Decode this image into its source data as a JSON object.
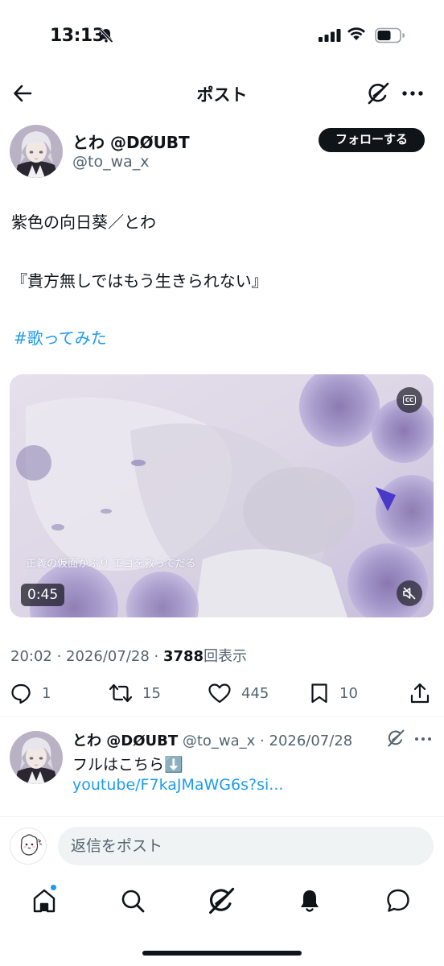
{
  "status_bar": {
    "time": "13:13"
  },
  "header": {
    "title": "ポスト"
  },
  "author": {
    "name": "とわ @DØUBT",
    "handle": "@to_wa_x",
    "follow_label": "フォローする"
  },
  "post": {
    "line1": "紫色の向日葵／とわ",
    "line2": "『貴方無しではもう生きられない』",
    "hashtag": "#歌ってみた"
  },
  "media": {
    "caption": "正義の仮面かぶり エゴを救ってだる",
    "duration": "0:45"
  },
  "meta": {
    "time_date": "20:02 · 2026/07/28 · ",
    "views": "3788",
    "views_label": "回表示"
  },
  "actions": {
    "replies": "1",
    "reposts": "15",
    "likes": "445",
    "bookmarks": "10"
  },
  "reply": {
    "name": "とわ @DØUBT",
    "handle_date": " @to_wa_x · 2026/07/28",
    "text": "フルはこちら⬇️",
    "link": "youtube/F7kaJMaWG6s?si..."
  },
  "compose": {
    "placeholder": "返信をポスト"
  },
  "colors": {
    "link": "#1d9bf0",
    "text": "#0f1419",
    "muted": "#536471"
  }
}
